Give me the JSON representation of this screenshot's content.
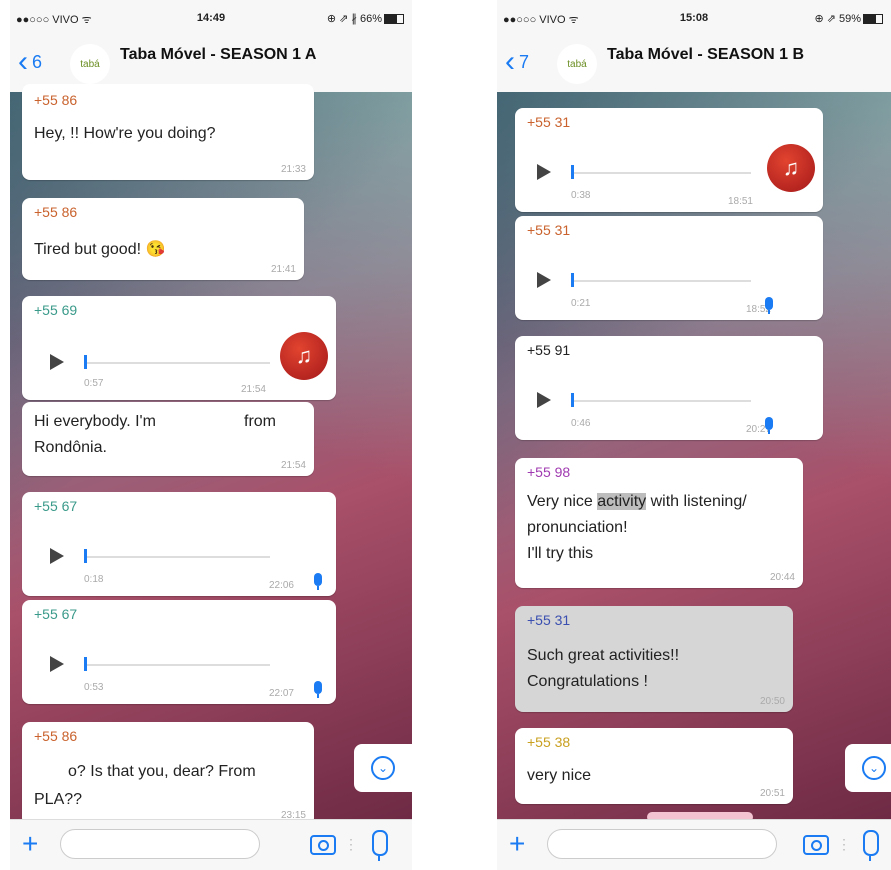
{
  "left": {
    "status": {
      "carrier": "●●○○○ VIVO ᯤ",
      "time": "14:49",
      "battery": "⊕ ⇗ ∦ 66%"
    },
    "nav": {
      "back_count": "6",
      "title": "Taba Móvel - SEASON 1 A",
      "avatar_text": "tabá"
    },
    "messages": [
      {
        "sender": "+55 86",
        "text": "Hey,            !! How're you doing?",
        "time": "21:33"
      },
      {
        "sender": "+55 86",
        "text": "Tired but good! 😘",
        "time": "21:41"
      },
      {
        "sender": "+55 69",
        "duration": "0:57",
        "time": "21:54"
      },
      {
        "text1": "Hi everybody. I'm",
        "text1b": "from",
        "text2": "Rondônia.",
        "time": "21:54"
      },
      {
        "sender": "+55 67",
        "duration": "0:18",
        "time": "22:06"
      },
      {
        "sender": "+55 67",
        "duration": "0:53",
        "time": "22:07"
      },
      {
        "sender": "+55 86",
        "text1": "o? Is that you, dear? From",
        "text2": "PLA??",
        "time": "23:15"
      }
    ]
  },
  "right": {
    "status": {
      "carrier": "●●○○○ VIVO ᯤ",
      "time": "15:08",
      "battery": "⊕ ⇗ 59%"
    },
    "nav": {
      "back_count": "7",
      "title": "Taba Móvel - SEASON 1 B",
      "avatar_text": "tabá"
    },
    "messages": [
      {
        "sender": "+55 31",
        "duration": "0:38",
        "time": "18:51"
      },
      {
        "sender": "+55 31",
        "duration": "0:21",
        "time": "18:52"
      },
      {
        "sender": "+55 91",
        "duration": "0:46",
        "time": "20:27"
      },
      {
        "sender": "+55 98",
        "text_pre": "Very nice ",
        "text_hl": "activity",
        "text_post": " with listening/",
        "text2": "pronunciation!",
        "text3": "I'll try this",
        "time": "20:44"
      },
      {
        "sender": "+55 31",
        "text1": "Such great activities!!",
        "text2": "Congratulations !",
        "time": "20:50"
      },
      {
        "sender": "+55 38",
        "text": "very nice",
        "time": "20:51"
      }
    ]
  },
  "colors": {
    "accent": "#1a7bf2",
    "sender_orange": "#c9622d",
    "sender_green": "#3a9a8a",
    "sender_purple": "#a03ab0",
    "sender_blue": "#3a4fb0",
    "sender_gold": "#c9a020"
  }
}
